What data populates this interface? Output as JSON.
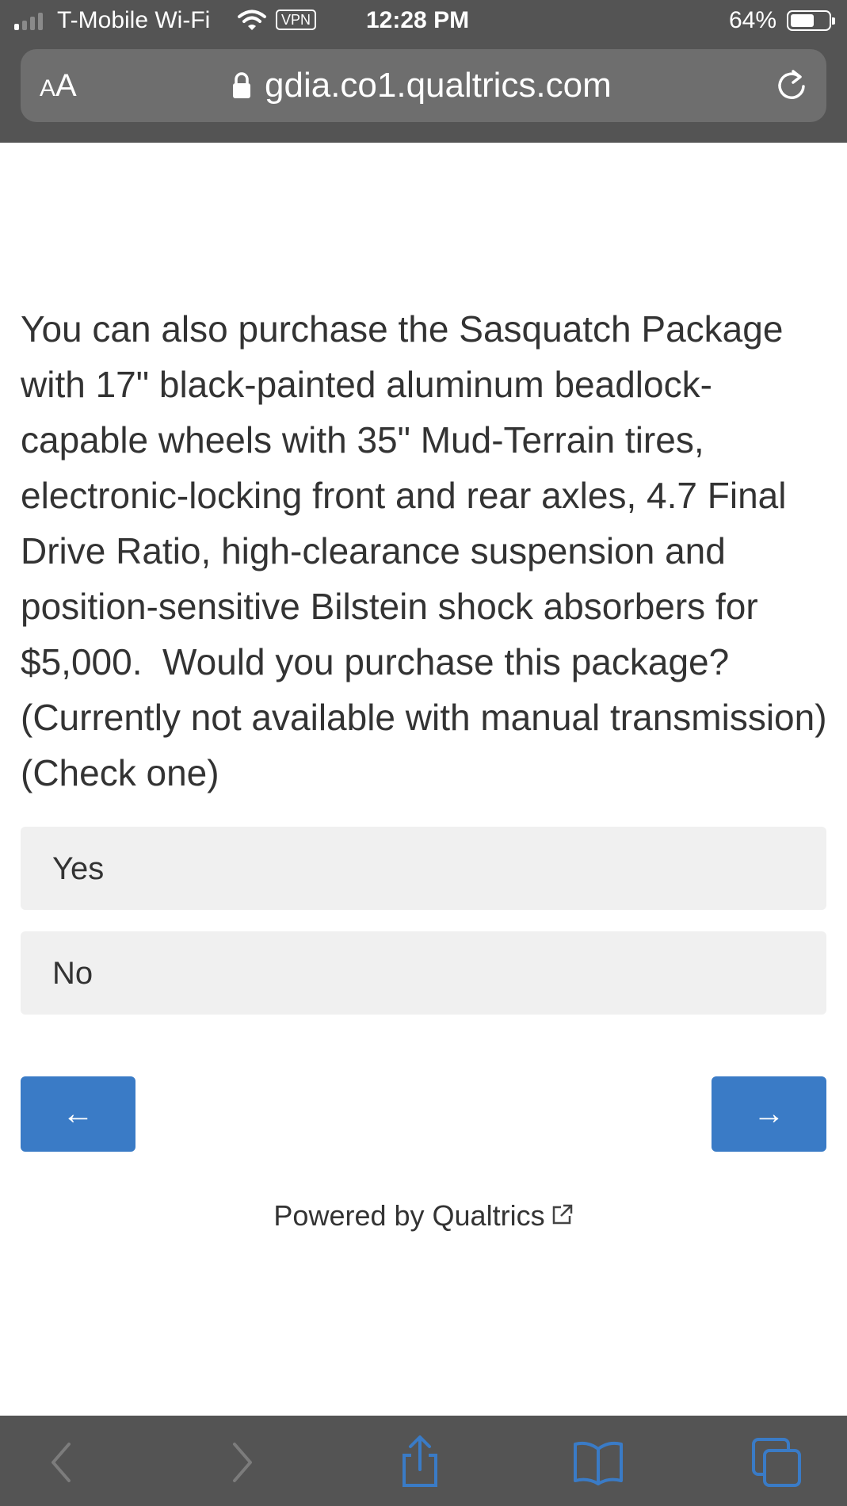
{
  "status_bar": {
    "carrier": "T-Mobile Wi-Fi",
    "vpn": "VPN",
    "time": "12:28 PM",
    "battery_percent": "64%",
    "battery_level": 0.64
  },
  "browser": {
    "aa_small": "A",
    "aa_large": "A",
    "url": "gdia.co1.qualtrics.com"
  },
  "survey": {
    "question": "You can also purchase the Sasquatch Package with 17\" black-painted aluminum beadlock-capable wheels with 35\" Mud-Terrain tires, electronic-locking front and rear axles, 4.7 Final Drive Ratio, high-clearance suspension and position-sensitive Bilstein shock absorbers for $5,000.  Would you purchase this package?  (Currently not available with manual transmission) (Check one)",
    "choices": [
      "Yes",
      "No"
    ],
    "back_label": "←",
    "next_label": "→",
    "powered_by": "Powered by Qualtrics"
  },
  "colors": {
    "chrome": "#545454",
    "url_field": "#6e6e6e",
    "choice_bg": "#f0f0f0",
    "button_blue": "#3a7bc6",
    "toolbar_blue_icon": "#3a7bc6",
    "toolbar_disabled_icon": "#7c7c7c"
  },
  "icons": [
    "signal-icon",
    "wifi-icon",
    "lock-icon",
    "reload-icon",
    "external-link-icon",
    "back-chevron-icon",
    "forward-chevron-icon",
    "share-icon",
    "bookmarks-icon",
    "tabs-icon"
  ]
}
